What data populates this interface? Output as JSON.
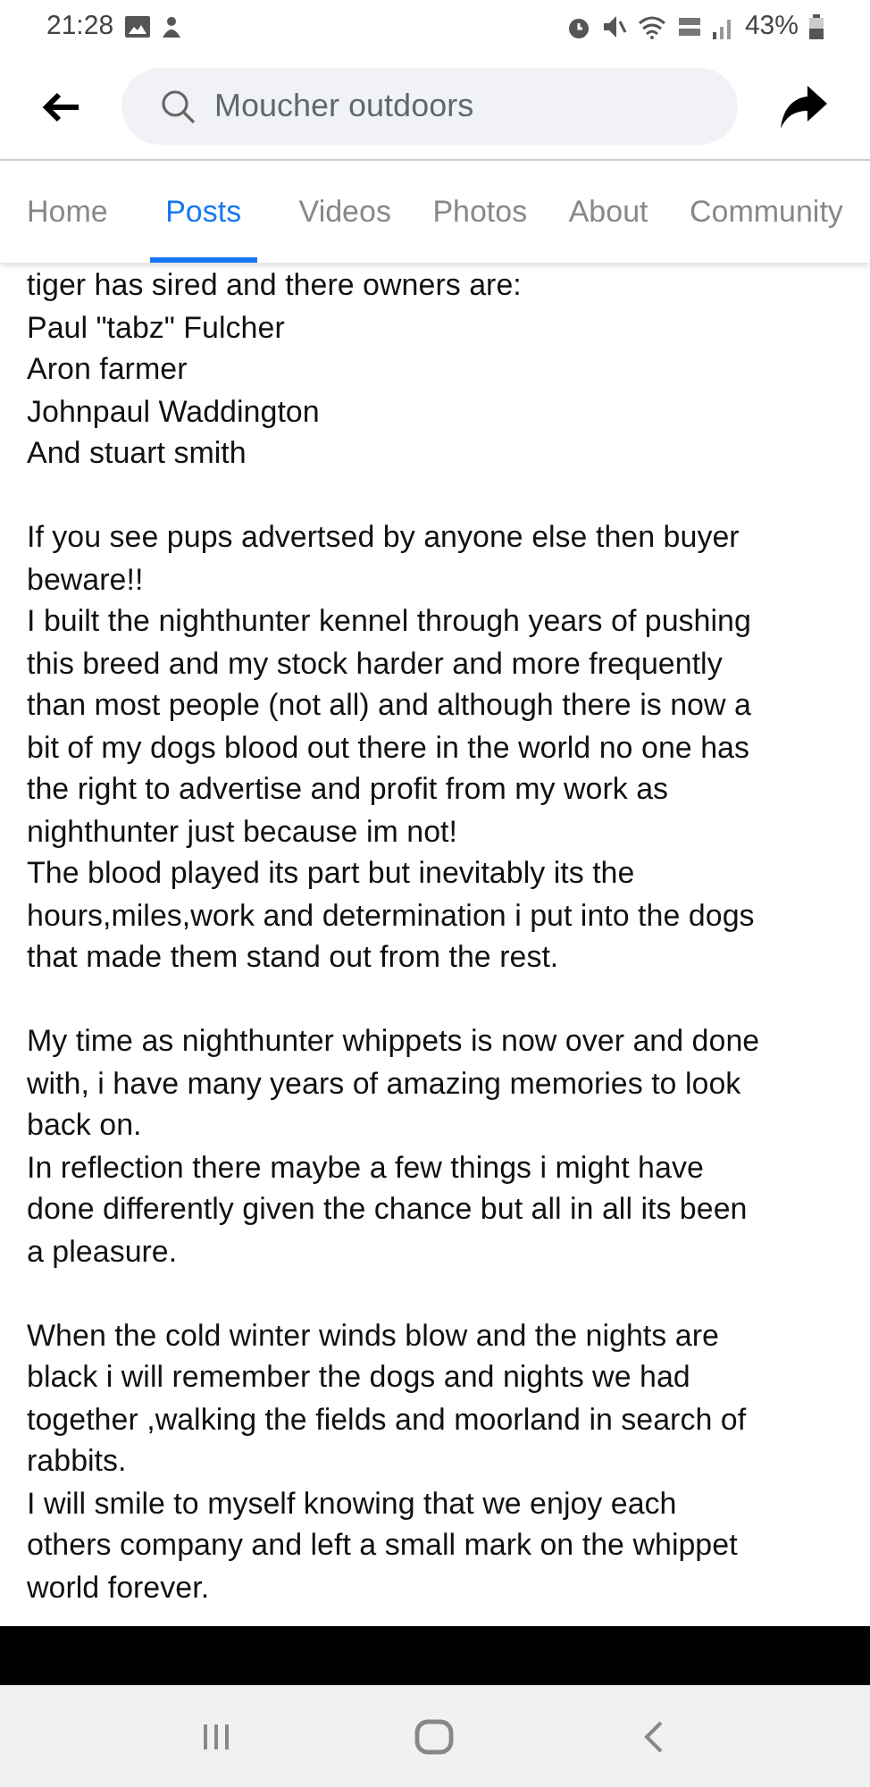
{
  "status_bar": {
    "time": "21:28",
    "battery": "43%"
  },
  "search": {
    "placeholder": "Moucher outdoors"
  },
  "tabs": [
    {
      "label": "Home",
      "selected": false
    },
    {
      "label": "Posts",
      "selected": true
    },
    {
      "label": "Videos",
      "selected": false
    },
    {
      "label": "Photos",
      "selected": false
    },
    {
      "label": "About",
      "selected": false
    },
    {
      "label": "Community",
      "selected": false
    }
  ],
  "post": {
    "sections": [
      [
        [
          "tiger has sired and there owners are:"
        ],
        [
          "Paul \"tabz\" Fulcher"
        ],
        [
          "Aron farmer"
        ],
        [
          "Johnpaul Waddington"
        ],
        [
          "And stuart smith"
        ]
      ],
      [
        [
          "If you see pups advertsed by anyone else then buyer",
          "beware!!"
        ],
        [
          "I built the nighthunter kennel through years of pushing",
          "this breed and my stock harder and more frequently",
          "than most people (not all) and although there is now a",
          "bit of my dogs blood out there in the world no one has",
          "the right to advertise and profit from my work as",
          "nighthunter just because im not!"
        ],
        [
          "The blood played its part but inevitably its the",
          "hours,miles,work and determination i put into the dogs",
          "that made them stand out from the rest."
        ]
      ],
      [
        [
          "My time as nighthunter whippets is now over and done",
          "with, i have many years of amazing memories to look",
          "back on."
        ],
        [
          "In reflection there maybe a few things i might have",
          "done differently given the chance but all in all its been",
          "a pleasure."
        ]
      ],
      [
        [
          "When the cold winter winds blow and the nights are",
          "black i will remember the dogs and nights we had",
          "together ,walking the fields and moorland in search of",
          "rabbits."
        ],
        [
          "I will smile to myself knowing that we enjoy each",
          "others company and left a small mark on the whippet",
          "world forever."
        ]
      ]
    ]
  }
}
